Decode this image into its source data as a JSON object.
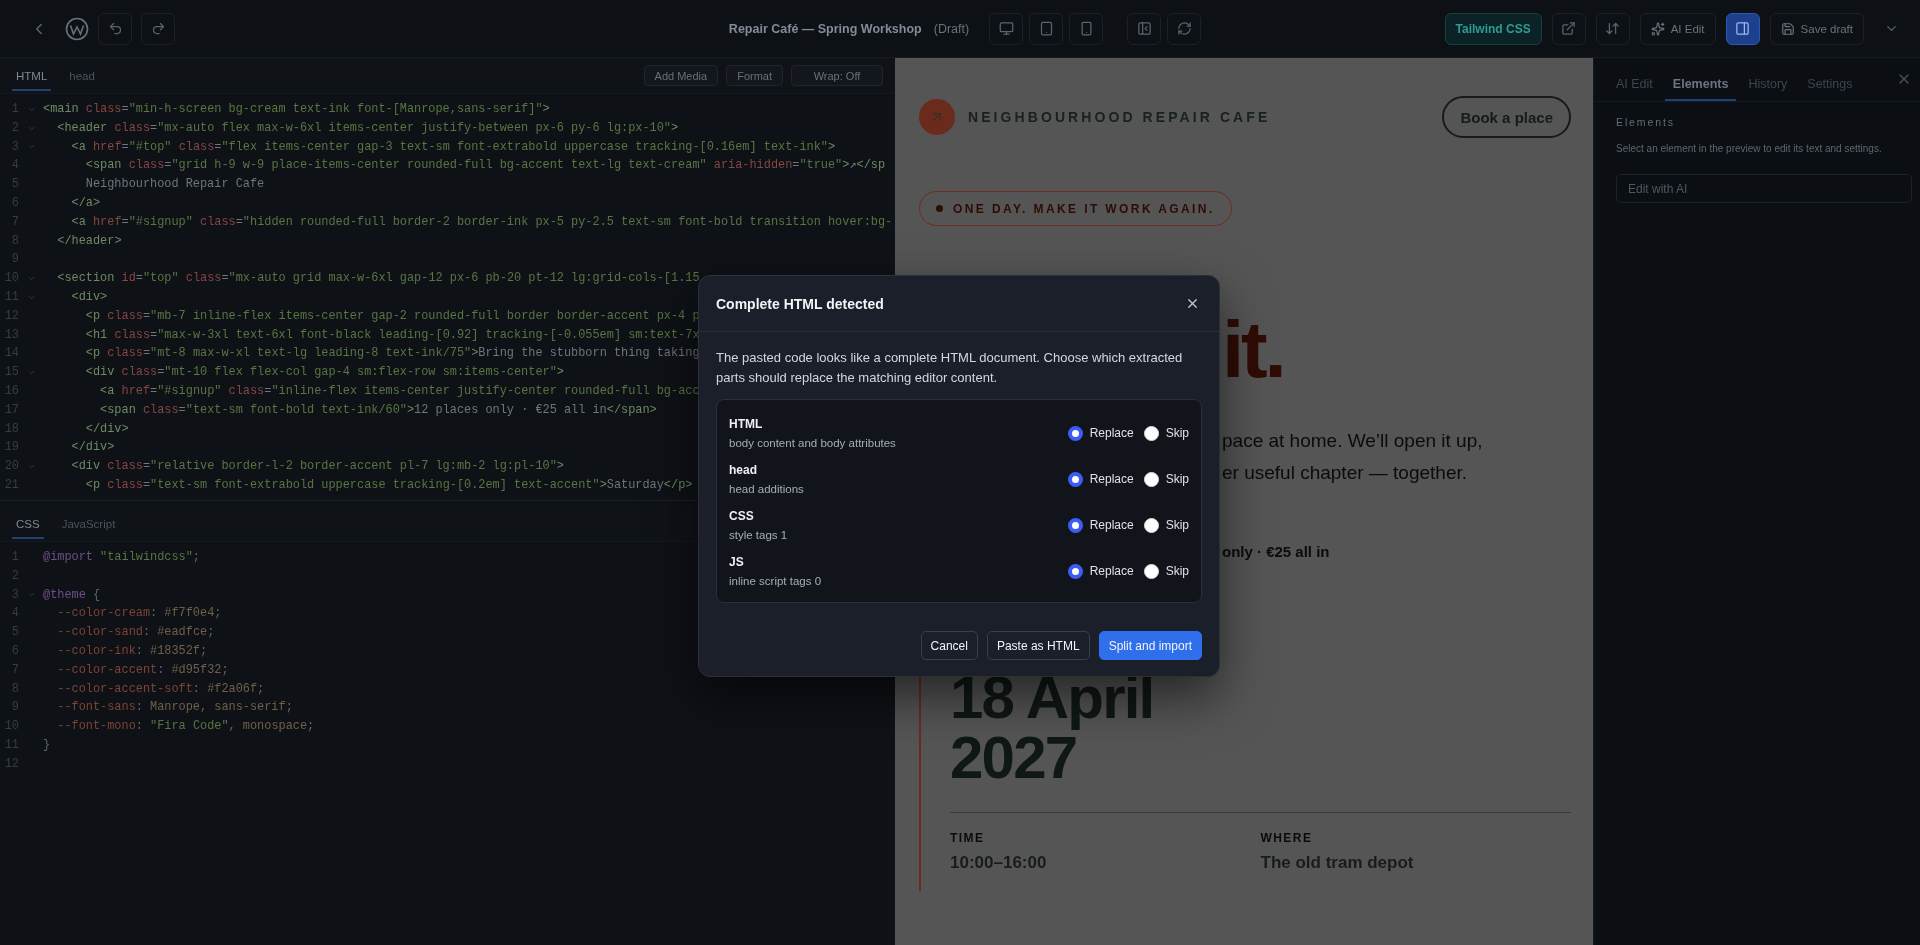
{
  "top_bar": {
    "title": "Repair Café — Spring Workshop",
    "status": "(Draft)",
    "badge": "Tailwind CSS",
    "ai_edit": "AI Edit",
    "save": "Save draft",
    "panel_toggle": {
      "on": true
    }
  },
  "html_editor": {
    "tabs": [
      {
        "label": "HTML",
        "selected": true
      },
      {
        "label": "head",
        "selected": false
      }
    ],
    "actions": [
      "Add Media",
      "Format",
      "Wrap: Off"
    ],
    "lines": [
      {
        "n": "1",
        "fold": true,
        "code": "<main class=\"min-h-screen bg-cream text-ink font-[Manrope,sans-serif]\">"
      },
      {
        "n": "2",
        "fold": true,
        "code": "  <header class=\"mx-auto flex max-w-6xl items-center justify-between px-6 py-6 lg:px-10\">"
      },
      {
        "n": "3",
        "fold": true,
        "code": "    <a href=\"#top\" class=\"flex items-center gap-3 text-sm font-extrabold uppercase tracking-[0.16em] text-ink\">"
      },
      {
        "n": "4",
        "fold": false,
        "code": "      <span class=\"grid h-9 w-9 place-items-center rounded-full bg-accent text-lg text-cream\" aria-hidden=\"true\">↗</sp"
      },
      {
        "n": "5",
        "fold": false,
        "code": "      Neighbourhood Repair Cafe"
      },
      {
        "n": "6",
        "fold": false,
        "code": "    </a>"
      },
      {
        "n": "7",
        "fold": false,
        "code": "    <a href=\"#signup\" class=\"hidden rounded-full border-2 border-ink px-5 py-2.5 text-sm font-bold transition hover:bg-"
      },
      {
        "n": "8",
        "fold": false,
        "code": "  </header>"
      },
      {
        "n": "9",
        "fold": false
      },
      {
        "n": "10",
        "fold": true,
        "code": "  <section id=\"top\" class=\"mx-auto grid max-w-6xl gap-12 px-6 pb-20 pt-12 lg:grid-cols-[1.15"
      },
      {
        "n": "11",
        "fold": true,
        "code": "    <div>"
      },
      {
        "n": "12",
        "fold": false,
        "code": "      <p class=\"mb-7 inline-flex items-center gap-2 rounded-full border border-accent px-4 p"
      },
      {
        "n": "13",
        "fold": false,
        "code": "      <h1 class=\"max-w-3xl text-6xl font-black leading-[0.92] tracking-[-0.055em] sm:text-7x"
      },
      {
        "n": "14",
        "fold": false,
        "code": "      <p class=\"mt-8 max-w-xl text-lg leading-8 text-ink/75\">Bring the stubborn thing taking"
      },
      {
        "n": "15",
        "fold": true,
        "code": "      <div class=\"mt-10 flex flex-col gap-4 sm:flex-row sm:items-center\">"
      },
      {
        "n": "16",
        "fold": false,
        "code": "        <a href=\"#signup\" class=\"inline-flex items-center justify-center rounded-full bg-acc"
      },
      {
        "n": "17",
        "fold": false,
        "code": "        <span class=\"text-sm font-bold text-ink/60\">12 places only · €25 all in</span>"
      },
      {
        "n": "18",
        "fold": false,
        "code": "      </div>"
      },
      {
        "n": "19",
        "fold": false,
        "code": "    </div>"
      },
      {
        "n": "20",
        "fold": true,
        "code": "    <div class=\"relative border-l-2 border-accent pl-7 lg:mb-2 lg:pl-10\">"
      },
      {
        "n": "21",
        "fold": false,
        "code": "      <p class=\"text-sm font-extrabold uppercase tracking-[0.2em] text-accent\">Saturday</p>"
      }
    ]
  },
  "css_editor": {
    "tabs": [
      {
        "label": "CSS",
        "selected": true
      },
      {
        "label": "JavaScript",
        "selected": false
      }
    ],
    "lines": [
      {
        "n": "1",
        "fold": false,
        "code": "@import \"tailwindcss\";"
      },
      {
        "n": "2",
        "fold": false
      },
      {
        "n": "3",
        "fold": true,
        "code": "@theme {"
      },
      {
        "n": "4",
        "fold": false,
        "code": "  --color-cream: #f7f0e4;"
      },
      {
        "n": "5",
        "fold": false,
        "code": "  --color-sand: #eadfce;"
      },
      {
        "n": "6",
        "fold": false,
        "code": "  --color-ink: #18352f;"
      },
      {
        "n": "7",
        "fold": false,
        "code": "  --color-accent: #d95f32;"
      },
      {
        "n": "8",
        "fold": false,
        "code": "  --color-accent-soft: #f2a06f;"
      },
      {
        "n": "9",
        "fold": false,
        "code": "  --font-sans: Manrope, sans-serif;"
      },
      {
        "n": "10",
        "fold": false,
        "code": "  --font-mono: \"Fira Code\", monospace;"
      },
      {
        "n": "11",
        "fold": false,
        "code": "}"
      },
      {
        "n": "12",
        "fold": false
      }
    ]
  },
  "preview": {
    "brand": "NEIGHBOURHOOD REPAIR CAFE",
    "cta": "Book a place",
    "pill": "ONE DAY. MAKE IT WORK AGAIN.",
    "heading_tail": "it.",
    "paragraph_lines": [
      "pace at home. We’ll open it up,",
      "er useful chapter — together."
    ],
    "note": "only · €25 all in",
    "date_lines": [
      "18 April",
      "2027"
    ],
    "facts": [
      {
        "label": "TIME",
        "value": "10:00–16:00"
      },
      {
        "label": "WHERE",
        "value": "The old tram depot"
      }
    ]
  },
  "side_panel": {
    "tabs": [
      {
        "label": "AI Edit",
        "selected": false
      },
      {
        "label": "Elements",
        "selected": true
      },
      {
        "label": "History",
        "selected": false
      },
      {
        "label": "Settings",
        "selected": false
      }
    ],
    "heading": "Elements",
    "hint": "Select an element in the preview to edit its text and settings.",
    "field": "Edit with AI"
  },
  "dialog": {
    "title": "Complete HTML detected",
    "text": "The pasted code looks like a complete HTML document. Choose which extracted parts should replace the matching editor content.",
    "parts": [
      {
        "label": "HTML",
        "description": "body content and body attributes",
        "options": [
          {
            "label": "Replace",
            "selected": true
          },
          {
            "label": "Skip",
            "selected": false
          }
        ]
      },
      {
        "label": "head",
        "description": "head additions",
        "options": [
          {
            "label": "Replace",
            "selected": true
          },
          {
            "label": "Skip",
            "selected": false
          }
        ]
      },
      {
        "label": "CSS",
        "description": "style tags 1",
        "options": [
          {
            "label": "Replace",
            "selected": true
          },
          {
            "label": "Skip",
            "selected": false
          }
        ]
      },
      {
        "label": "JS",
        "description": "inline script tags 0",
        "options": [
          {
            "label": "Replace",
            "selected": true
          },
          {
            "label": "Skip",
            "selected": false
          }
        ]
      }
    ],
    "buttons": [
      {
        "label": "Cancel",
        "kind": "secondary"
      },
      {
        "label": "Paste as HTML",
        "kind": "secondary"
      },
      {
        "label": "Split and import",
        "kind": "primary"
      }
    ]
  }
}
